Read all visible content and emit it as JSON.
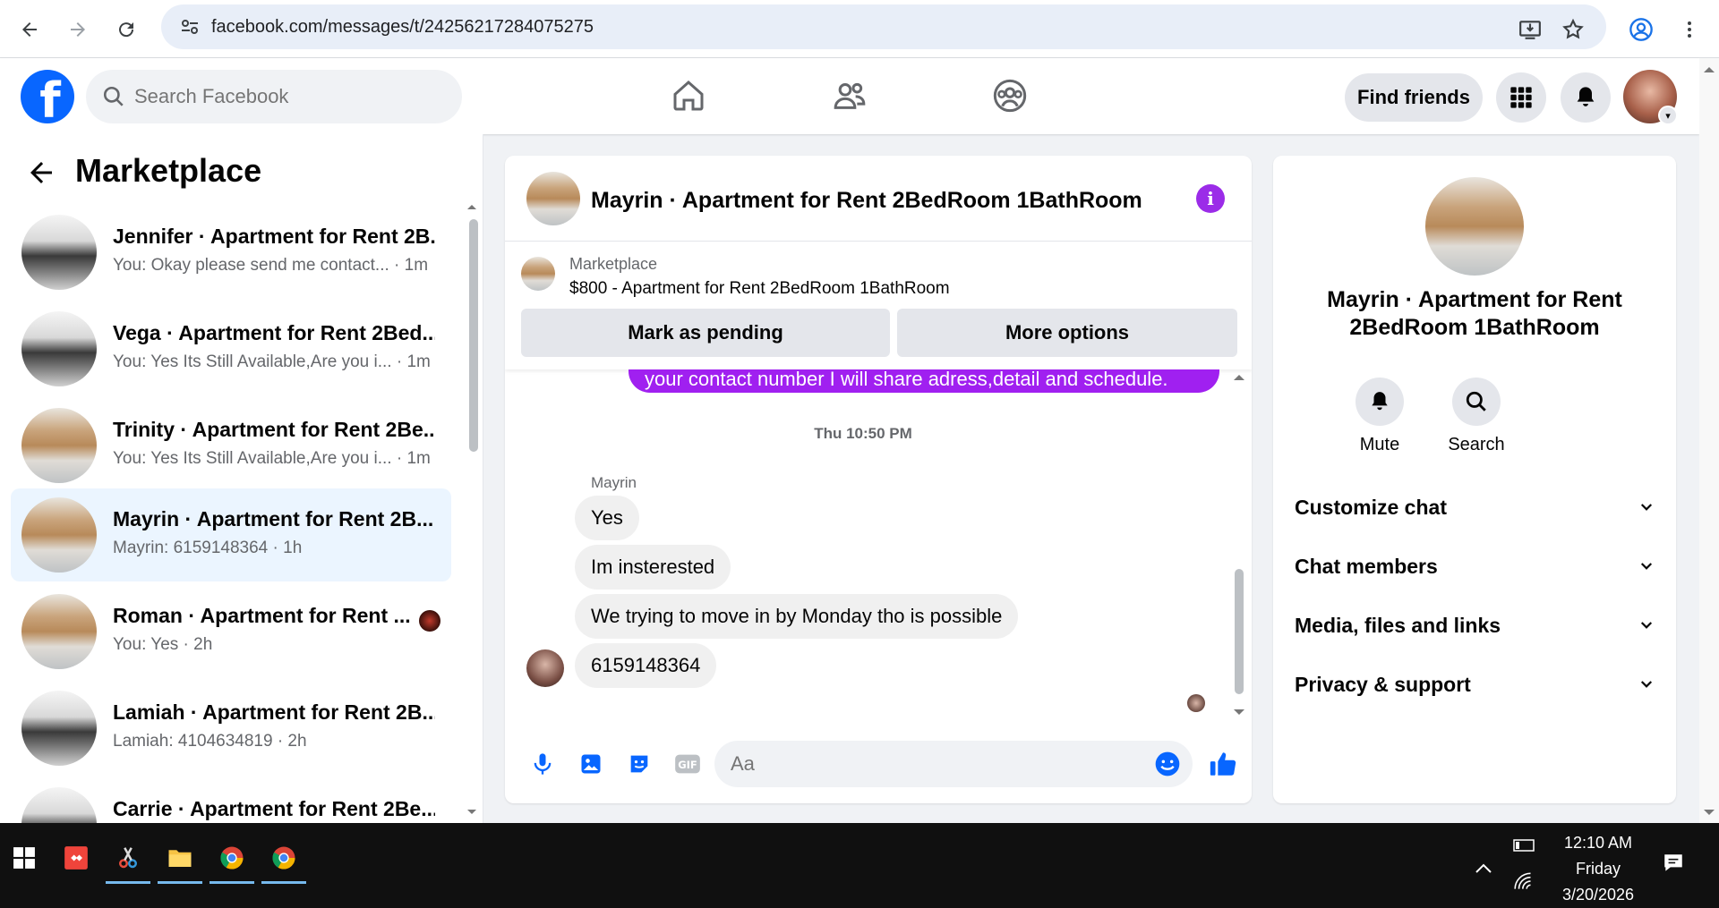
{
  "browser": {
    "url": "facebook.com/messages/t/24256217284075275"
  },
  "header": {
    "search_placeholder": "Search Facebook",
    "find_friends_label": "Find friends"
  },
  "sidebar": {
    "title": "Marketplace",
    "chats": [
      {
        "name": "Jennifer · Apartment for Rent 2B...",
        "preview": "You: Okay please send me contact... · 1m",
        "thumb": "kitchen"
      },
      {
        "name": "Vega · Apartment for Rent 2Bed...",
        "preview": "You: Yes Its Still Available,Are you i... · 1m",
        "thumb": "kitchen"
      },
      {
        "name": "Trinity · Apartment for Rent 2Be...",
        "preview": "You: Yes Its Still Available,Are you i... · 1m",
        "thumb": "wood"
      },
      {
        "name": "Mayrin · Apartment for Rent 2B...",
        "preview": "Mayrin: 6159148364 · 1h",
        "thumb": "wood"
      },
      {
        "name": "Roman · Apartment for Rent ...",
        "preview": "You: Yes · 2h",
        "thumb": "wood"
      },
      {
        "name": "Lamiah · Apartment for Rent 2B...",
        "preview": "Lamiah: 4104634819 · 2h",
        "thumb": "kitchen"
      },
      {
        "name": "Carrie · Apartment for Rent 2Be...",
        "preview": "",
        "thumb": "kitchen"
      }
    ]
  },
  "conversation": {
    "title": "Mayrin · Apartment for Rent 2BedRoom 1BathRoom",
    "listing_label": "Marketplace",
    "listing_title": "$800 - Apartment for Rent 2BedRoom 1BathRoom",
    "mark_pending_label": "Mark as pending",
    "more_options_label": "More options",
    "outgoing_partial": "your contact number I will share adress,detail and schedule.",
    "timestamp": "Thu 10:50 PM",
    "sender": "Mayrin",
    "incoming": [
      "Yes",
      "Im insterested",
      "We trying to move in by Monday tho is possible",
      "6159148364"
    ],
    "composer_placeholder": "Aa"
  },
  "info_panel": {
    "name": "Mayrin · Apartment for Rent 2BedRoom 1BathRoom",
    "mute_label": "Mute",
    "search_label": "Search",
    "sections": [
      "Customize chat",
      "Chat members",
      "Media, files and links",
      "Privacy & support"
    ]
  },
  "taskbar": {
    "time": "12:10 AM",
    "day": "Friday",
    "date": "3/20/2026"
  },
  "colors": {
    "fb_blue": "#0866ff",
    "messenger_purple": "#a020f0",
    "active_chat_bg": "#ebf5ff"
  }
}
